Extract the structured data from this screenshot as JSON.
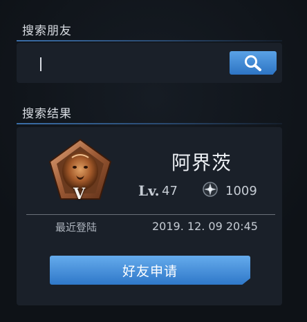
{
  "search_section": {
    "title": "搜索朋友",
    "input_value": "",
    "button_icon": "search-icon"
  },
  "results_section": {
    "title": "搜索结果",
    "player": {
      "name": "阿界茨",
      "rank_badge_icon": "lion-rank-badge-icon",
      "rank_roman": "V",
      "level_label": "Lv.",
      "level": "47",
      "score_icon": "rank-emblem-icon",
      "score": "1009",
      "last_login_label": "最近登陆",
      "last_login": "2019. 12. 09 20:45"
    },
    "add_friend_label": "好友申请"
  },
  "colors": {
    "accent": "#3f8ad8",
    "panel": "#1a2029",
    "background": "#101419"
  }
}
